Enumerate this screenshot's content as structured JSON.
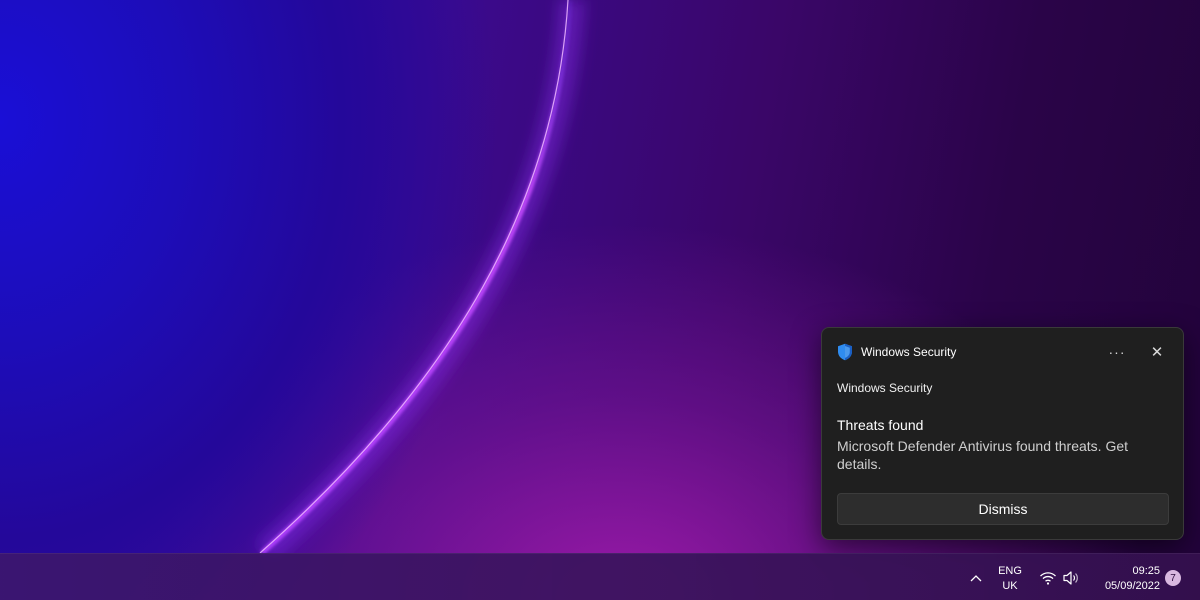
{
  "toast": {
    "app_name": "Windows Security",
    "more_glyph": "···",
    "close_glyph": "✕",
    "attribution": "Windows Security",
    "title": "Threats found",
    "body": "Microsoft Defender Antivirus found threats. Get details.",
    "dismiss_label": "Dismiss",
    "app_icon": "shield-icon"
  },
  "taskbar": {
    "language_line1": "ENG",
    "language_line2": "UK",
    "time": "09:25",
    "date": "05/09/2022",
    "notification_count": "7",
    "icons": [
      "chevron-up-icon",
      "wifi-icon",
      "volume-icon"
    ]
  },
  "colors": {
    "toast_bg": "#1f1f1f",
    "shield_blue": "#2f8cf0",
    "badge": "#d9b8e0",
    "arc_glow": "#c64bff"
  }
}
